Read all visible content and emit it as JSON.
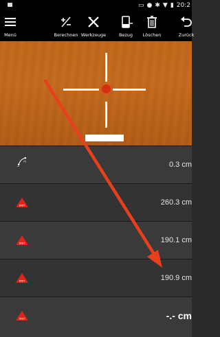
{
  "status_bar": {
    "time": "20:2"
  },
  "toolbar": {
    "items": [
      {
        "label": "Menü",
        "icon": "menu-icon"
      },
      {
        "label": "Berechnen",
        "icon": "calculate-icon"
      },
      {
        "label": "Werkzeuge",
        "icon": "tools-icon"
      },
      {
        "label": "Bezug",
        "icon": "reference-icon"
      },
      {
        "label": "Löschen",
        "icon": "trash-icon"
      },
      {
        "label": "Zurück",
        "icon": "undo-icon"
      }
    ]
  },
  "measurements": [
    {
      "icon": "p1-p2-icon",
      "icon_label": "P2",
      "icon_label2": "P1",
      "value": "0.3 cm"
    },
    {
      "icon": "dist-icon",
      "icon_label": "DIST",
      "value": "260.3 cm"
    },
    {
      "icon": "dist-icon",
      "icon_label": "DIST",
      "value": "190.1 cm"
    },
    {
      "icon": "dist-icon",
      "icon_label": "DIST",
      "value": "190.9 cm"
    },
    {
      "icon": "dist-icon",
      "icon_label": "DIST",
      "value": "-.- cm"
    }
  ],
  "colors": {
    "accent_red": "#e2231a",
    "annotation_arrow": "#e8401c",
    "background": "#2a2a2a"
  }
}
